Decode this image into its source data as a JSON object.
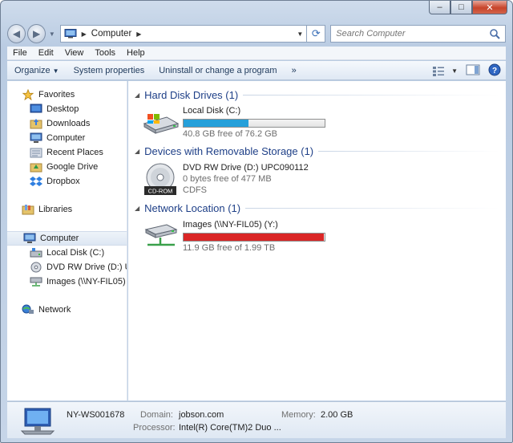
{
  "window": {
    "minimize_glyph": "–",
    "maximize_glyph": "□",
    "close_glyph": "✕"
  },
  "address_bar": {
    "breadcrumb": "Computer",
    "search_placeholder": "Search Computer"
  },
  "menu": [
    "File",
    "Edit",
    "View",
    "Tools",
    "Help"
  ],
  "command_bar": {
    "organize": "Organize",
    "system_properties": "System properties",
    "uninstall": "Uninstall or change a program",
    "more": "»"
  },
  "nav_pane": {
    "favorites_header": "Favorites",
    "favorites": [
      "Desktop",
      "Downloads",
      "Computer",
      "Recent Places",
      "Google Drive",
      "Dropbox"
    ],
    "libraries": "Libraries",
    "computer": "Computer",
    "computer_children": [
      "Local Disk (C:)",
      "DVD RW Drive (D:) U",
      "Images (\\\\NY-FIL05)"
    ],
    "network": "Network"
  },
  "groups": {
    "hard_disk": {
      "title": "Hard Disk Drives (1)",
      "drive_name": "Local Disk (C:)",
      "free_text": "40.8 GB free of 76.2 GB",
      "used_fraction": 0.46,
      "bar_color": "#26a0da"
    },
    "removable": {
      "title": "Devices with Removable Storage (1)",
      "drive_name": "DVD RW Drive (D:) UPC090112",
      "free_text": "0 bytes free of 477 MB",
      "filesystem": "CDFS",
      "icon_label": "CD-ROM"
    },
    "network": {
      "title": "Network Location (1)",
      "drive_name": "Images (\\\\NY-FIL05) (Y:)",
      "free_text": "11.9 GB free of 1.99 TB",
      "used_fraction": 0.994,
      "bar_color": "#da2626"
    }
  },
  "details": {
    "hostname": "NY-WS001678",
    "domain_label": "Domain:",
    "domain_value": "jobson.com",
    "memory_label": "Memory:",
    "memory_value": "2.00 GB",
    "processor_label": "Processor:",
    "processor_value": "Intel(R) Core(TM)2 Duo ..."
  }
}
